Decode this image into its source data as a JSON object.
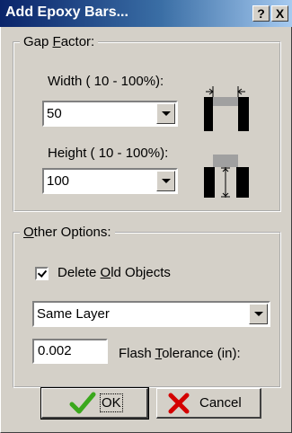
{
  "window": {
    "title": "Add Epoxy Bars...",
    "help_label": "?",
    "close_label": "X"
  },
  "gap_factor": {
    "legend_before": "Gap ",
    "legend_underlined": "F",
    "legend_after": "actor:",
    "width_label": "Width ( 10 - 100%):",
    "width_value": "50",
    "height_label": "Height ( 10 - 100%):",
    "height_value": "100"
  },
  "other_options": {
    "legend_underlined": "O",
    "legend_after": "ther Options:",
    "delete_checked": true,
    "delete_before": "Delete ",
    "delete_underlined": "O",
    "delete_after": "ld Objects",
    "layer_value": "Same Layer",
    "tolerance_value": "0.002",
    "tolerance_before": "Flash ",
    "tolerance_underlined": "T",
    "tolerance_after": "olerance (in):"
  },
  "buttons": {
    "ok_label": "OK",
    "cancel_label": "Cancel"
  },
  "colors": {
    "ok_check": "#3aa81c",
    "cancel_x": "#d40000"
  }
}
